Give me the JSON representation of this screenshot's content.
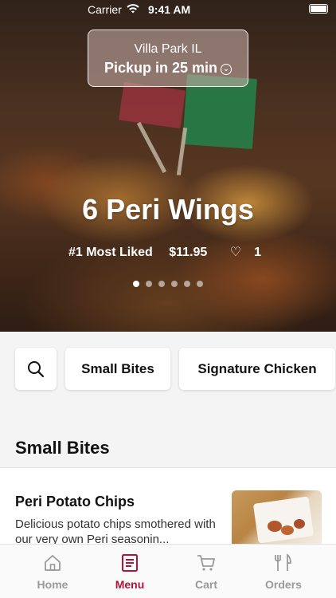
{
  "status_bar": {
    "carrier": "Carrier",
    "time": "9:41 AM"
  },
  "location": {
    "city": "Villa Park IL",
    "pickup": "Pickup in 25 min"
  },
  "featured": {
    "title": "6 Peri Wings",
    "tag": "#1 Most Liked",
    "price": "$11.95",
    "likes": "1",
    "slide_count": 6,
    "active_slide": 1
  },
  "categories": [
    "Small Bites",
    "Signature Chicken"
  ],
  "section": {
    "title": "Small Bites"
  },
  "menu_item": {
    "name": "Peri Potato Chips",
    "description": "Delicious potato chips smothered with our very own Peri seasonin..."
  },
  "tabs": [
    {
      "label": "Home",
      "icon": "home-icon"
    },
    {
      "label": "Menu",
      "icon": "menu-icon",
      "active": true
    },
    {
      "label": "Cart",
      "icon": "cart-icon"
    },
    {
      "label": "Orders",
      "icon": "orders-icon"
    }
  ],
  "colors": {
    "accent": "#b3123a",
    "inactive": "#9a9a9a"
  }
}
